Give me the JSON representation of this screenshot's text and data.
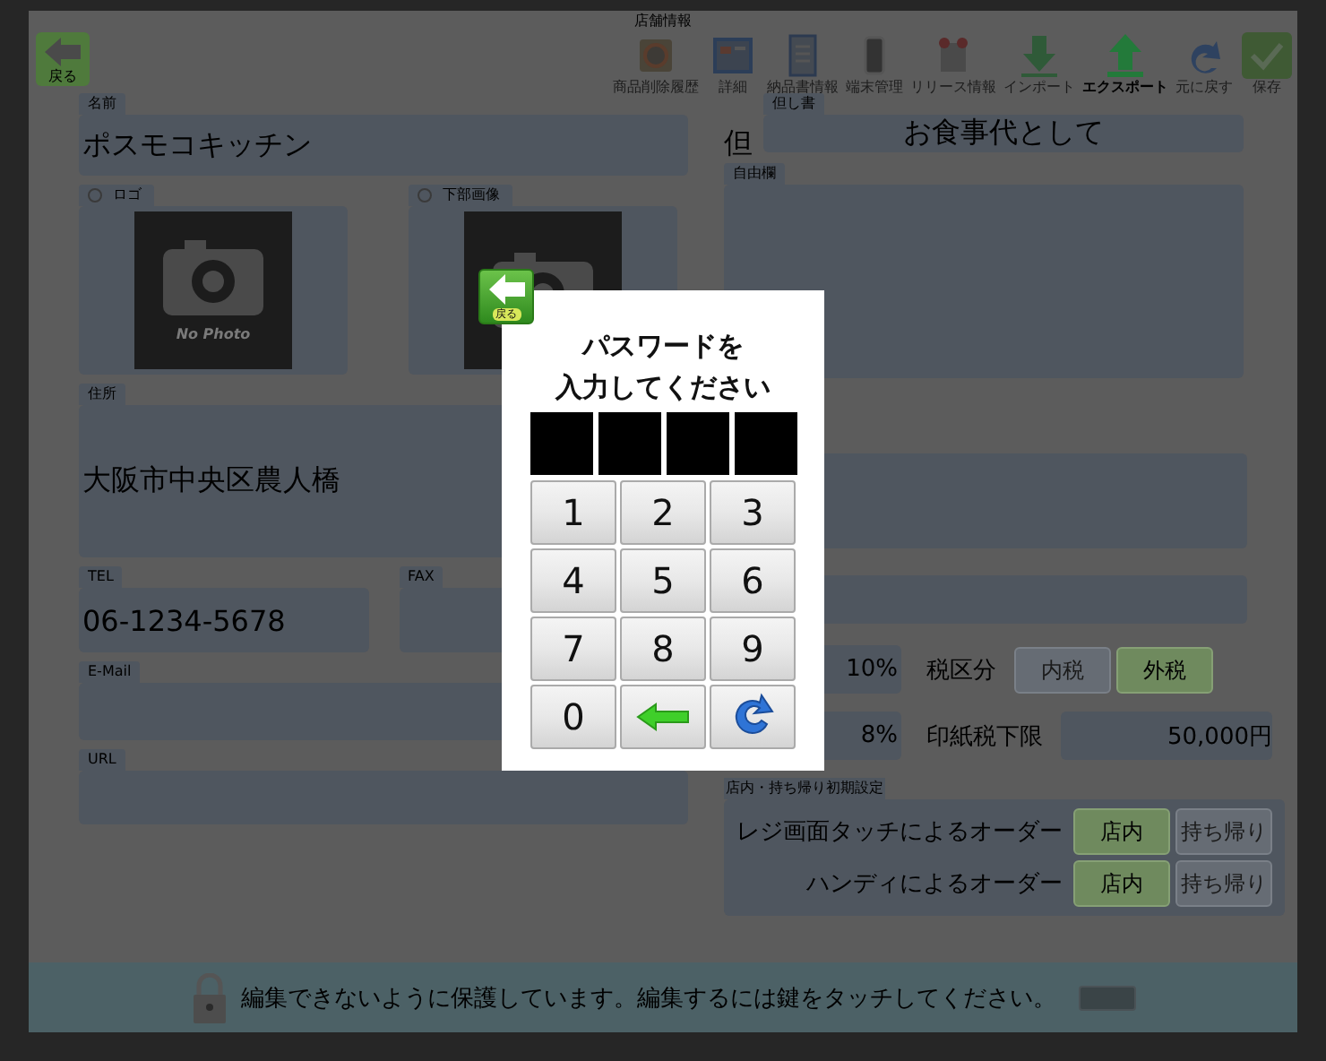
{
  "window": {
    "title": "店舗情報"
  },
  "toolbar": {
    "back": {
      "label": "戻る"
    },
    "items": [
      {
        "kind": "history",
        "label": "商品削除履歴",
        "highlighted": false
      },
      {
        "kind": "detail",
        "label": "詳細",
        "highlighted": false
      },
      {
        "kind": "invoice",
        "label": "納品書情報",
        "highlighted": false
      },
      {
        "kind": "device",
        "label": "端末管理",
        "highlighted": false
      },
      {
        "kind": "release",
        "label": "リリース情報",
        "highlighted": false
      },
      {
        "kind": "import",
        "label": "インポート",
        "highlighted": false
      },
      {
        "kind": "export",
        "label": "エクスポート",
        "highlighted": true
      },
      {
        "kind": "undo",
        "label": "元に戻す",
        "highlighted": false
      },
      {
        "kind": "save",
        "label": "保存",
        "highlighted": false
      }
    ]
  },
  "left": {
    "name": {
      "label": "名前",
      "value": "ポスモコキッチン"
    },
    "images": [
      {
        "label": "ロゴ",
        "checked": false,
        "caption": "No Photo"
      },
      {
        "label": "下部画像",
        "checked": false
      }
    ],
    "address": {
      "label": "住所",
      "value": "大阪市中央区農人橋"
    },
    "tel": {
      "label": "TEL",
      "value": "06-1234-5678"
    },
    "fax": {
      "label": "FAX"
    },
    "email": {
      "label": "E-Mail"
    },
    "url": {
      "label": "URL"
    }
  },
  "right": {
    "proviso": {
      "prefix": "但",
      "label": "但し書",
      "value": "お食事代として"
    },
    "free": {
      "label": "自由欄"
    },
    "tax_rows": [
      {
        "kind": "options",
        "rate": "10%",
        "label": "税区分",
        "options": [
          {
            "label": "内税",
            "selected": false
          },
          {
            "label": "外税",
            "selected": true
          }
        ]
      },
      {
        "kind": "amount",
        "rate": "8%",
        "label": "印紙税下限",
        "value": "50,000円"
      }
    ],
    "order_defaults": {
      "title": "店内・持ち帰り初期設定",
      "rows": [
        {
          "label": "レジ画面タッチによるオーダー",
          "options": [
            {
              "label": "店内",
              "selected": true
            },
            {
              "label": "持ち帰り",
              "selected": false
            }
          ]
        },
        {
          "label": "ハンディによるオーダー",
          "options": [
            {
              "label": "店内",
              "selected": true
            },
            {
              "label": "持ち帰り",
              "selected": false
            }
          ]
        }
      ]
    }
  },
  "notice": {
    "message": "編集できないように保護しています。編集するには鍵をタッチしてください。"
  },
  "password_dialog": {
    "back": {
      "label": "戻る"
    },
    "title_lines": [
      "パスワードを",
      "入力してください"
    ],
    "pin_slots": [
      {
        "filled": false
      },
      {
        "filled": false
      },
      {
        "filled": false
      },
      {
        "filled": false
      }
    ],
    "keys": [
      {
        "kind": "digit",
        "label": "1"
      },
      {
        "kind": "digit",
        "label": "2"
      },
      {
        "kind": "digit",
        "label": "3"
      },
      {
        "kind": "digit",
        "label": "4"
      },
      {
        "kind": "digit",
        "label": "5"
      },
      {
        "kind": "digit",
        "label": "6"
      },
      {
        "kind": "digit",
        "label": "7"
      },
      {
        "kind": "digit",
        "label": "8"
      },
      {
        "kind": "digit",
        "label": "9"
      },
      {
        "kind": "digit",
        "label": "0"
      },
      {
        "kind": "backspace"
      },
      {
        "kind": "reset"
      }
    ]
  }
}
